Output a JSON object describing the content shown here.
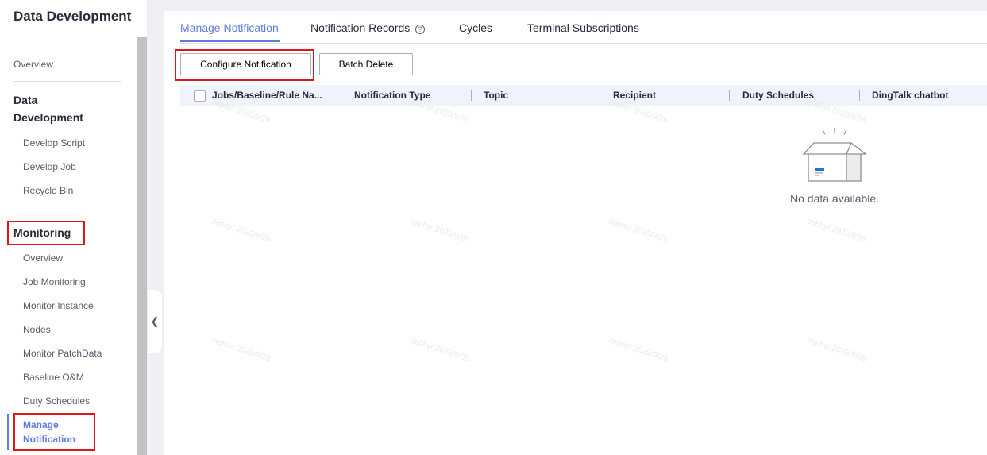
{
  "sidebar": {
    "title": "Data Development",
    "overview": "Overview",
    "group1": "Data Development",
    "group1_items": [
      "Develop Script",
      "Develop Job",
      "Recycle Bin"
    ],
    "group2": "Monitoring",
    "group2_items": [
      "Overview",
      "Job Monitoring",
      "Monitor Instance",
      "Nodes",
      "Monitor PatchData",
      "Baseline O&M",
      "Duty Schedules",
      "Manage Notification"
    ]
  },
  "tabs": [
    "Manage Notification",
    "Notification Records",
    "Cycles",
    "Terminal Subscriptions"
  ],
  "toolbar": {
    "configure": "Configure Notification",
    "batch_delete": "Batch Delete"
  },
  "table": {
    "columns": [
      "Jobs/Baseline/Rule Na...",
      "Notification Type",
      "Topic",
      "Recipient",
      "Duty Schedules",
      "DingTalk chatbot"
    ],
    "empty_text": "No data available."
  },
  "watermark": "zephyr 2025/9/26",
  "colors": {
    "accent": "#5e7ce0",
    "highlight": "#e0161a"
  }
}
